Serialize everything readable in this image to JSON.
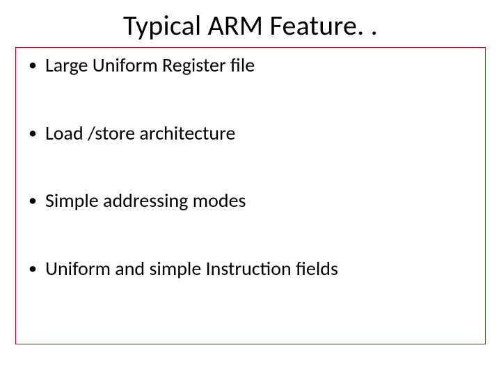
{
  "title": "Typical ARM Feature. .",
  "bullets": [
    "Large Uniform Register file",
    "Load /store architecture",
    "Simple addressing modes",
    "Uniform and simple Instruction fields"
  ]
}
